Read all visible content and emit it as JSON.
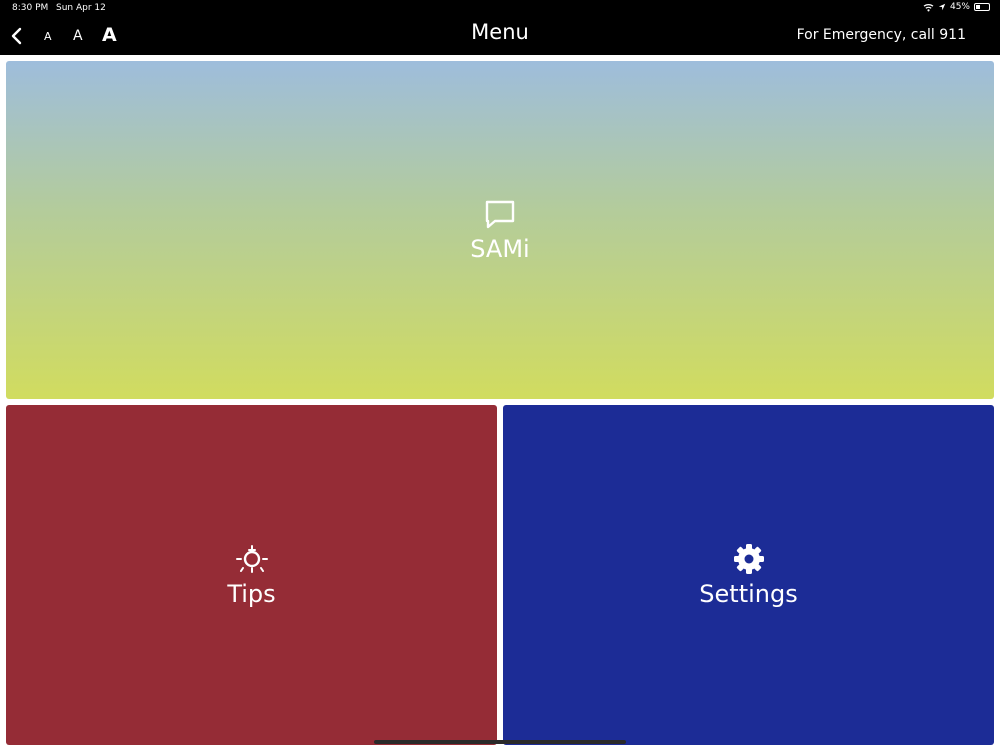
{
  "status_bar": {
    "time": "8:30 PM",
    "date": "Sun Apr 12",
    "battery": "45%",
    "battery_level": 0.45
  },
  "header": {
    "title": "Menu",
    "emergency": "For Emergency, call 911",
    "font_size_labels": [
      "A",
      "A",
      "A"
    ]
  },
  "tiles": [
    {
      "label": "SAMi",
      "icon": "chat-bubble-icon",
      "color": "#9ebddc"
    },
    {
      "label": "Tips",
      "icon": "lightbulb-icon",
      "color": "#952c36"
    },
    {
      "label": "Settings",
      "icon": "gear-icon",
      "color": "#1c2c96"
    }
  ]
}
